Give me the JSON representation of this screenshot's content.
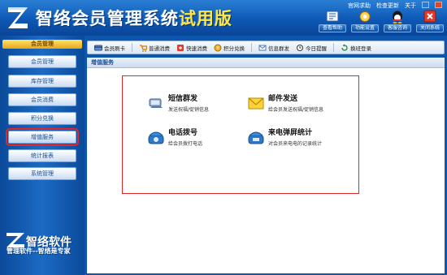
{
  "header": {
    "app_title_main": "智络会员管理系统",
    "app_title_trial": "试用版",
    "top_links": [
      "官网求助",
      "检查更新",
      "关于"
    ],
    "tool_buttons": [
      {
        "label": "查看帮助",
        "icon": "help-icon"
      },
      {
        "label": "功能设置",
        "icon": "settings-icon"
      },
      {
        "label": "客服咨询",
        "icon": "support-icon"
      },
      {
        "label": "关闭系统",
        "icon": "close-icon"
      }
    ]
  },
  "sidebar": {
    "heading": "会员管理",
    "items": [
      {
        "label": "会员管理",
        "active": false
      },
      {
        "label": "库存管理",
        "active": false
      },
      {
        "label": "会员消费",
        "active": false
      },
      {
        "label": "积分兑换",
        "active": false
      },
      {
        "label": "增值服务",
        "active": true
      },
      {
        "label": "统计报表",
        "active": false
      },
      {
        "label": "系统管理",
        "active": false
      }
    ],
    "brand": "智络软件",
    "slogan": "管理软件--智络是专家"
  },
  "toolbar": {
    "items": [
      {
        "label": "会员刷卡",
        "icon": "card-icon"
      },
      {
        "label": "普通消费",
        "icon": "consume-icon"
      },
      {
        "label": "快速消费",
        "icon": "fast-consume-icon"
      },
      {
        "label": "积分兑换",
        "icon": "points-icon"
      },
      {
        "label": "信息群发",
        "icon": "message-icon"
      },
      {
        "label": "今日提醒",
        "icon": "reminder-icon"
      },
      {
        "label": "换班登录",
        "icon": "shift-login-icon"
      }
    ]
  },
  "panel": {
    "title": "增值服务",
    "services": [
      {
        "title": "短信群发",
        "desc": "发送祝福/促销信息",
        "icon": "sms-icon"
      },
      {
        "title": "邮件发送",
        "desc": "给会员发送祝福/促销信息",
        "icon": "mail-icon"
      },
      {
        "title": "电话拨号",
        "desc": "给会员拨打电话",
        "icon": "phone-icon"
      },
      {
        "title": "来电弹屏统计",
        "desc": "对会员来电电的记录统计",
        "icon": "callerid-icon"
      }
    ]
  },
  "colors": {
    "header_blue": "#0d58b5",
    "highlight_red": "#e0282b",
    "trial_yellow": "#ffe640"
  }
}
